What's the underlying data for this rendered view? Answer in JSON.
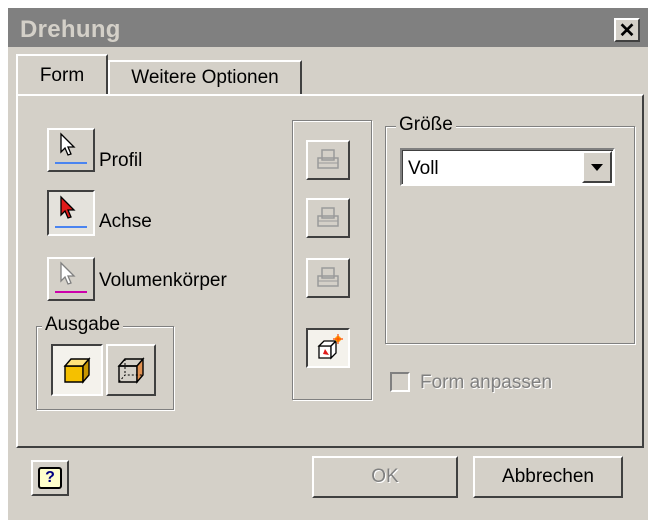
{
  "window": {
    "title": "Drehung",
    "close_symbol": "✕"
  },
  "tabs": [
    {
      "label": "Form"
    },
    {
      "label": "Weitere Optionen"
    }
  ],
  "selectors": [
    {
      "label": "Profil",
      "icon": "select-arrow-icon",
      "underline": "#4a84f0"
    },
    {
      "label": "Achse",
      "icon": "select-arrow-red-icon",
      "underline": "#4a84f0"
    },
    {
      "label": "Volumenkörper",
      "icon": "select-arrow-gray-icon",
      "underline": "#cc00aa"
    }
  ],
  "ausgabe": {
    "label": "Ausgabe"
  },
  "groesse": {
    "label": "Größe",
    "selected": "Voll"
  },
  "form_anpassen": {
    "label": "Form anpassen",
    "checked": false
  },
  "footer": {
    "help_symbol": "?",
    "ok_label": "OK",
    "cancel_label": "Abbrechen"
  }
}
